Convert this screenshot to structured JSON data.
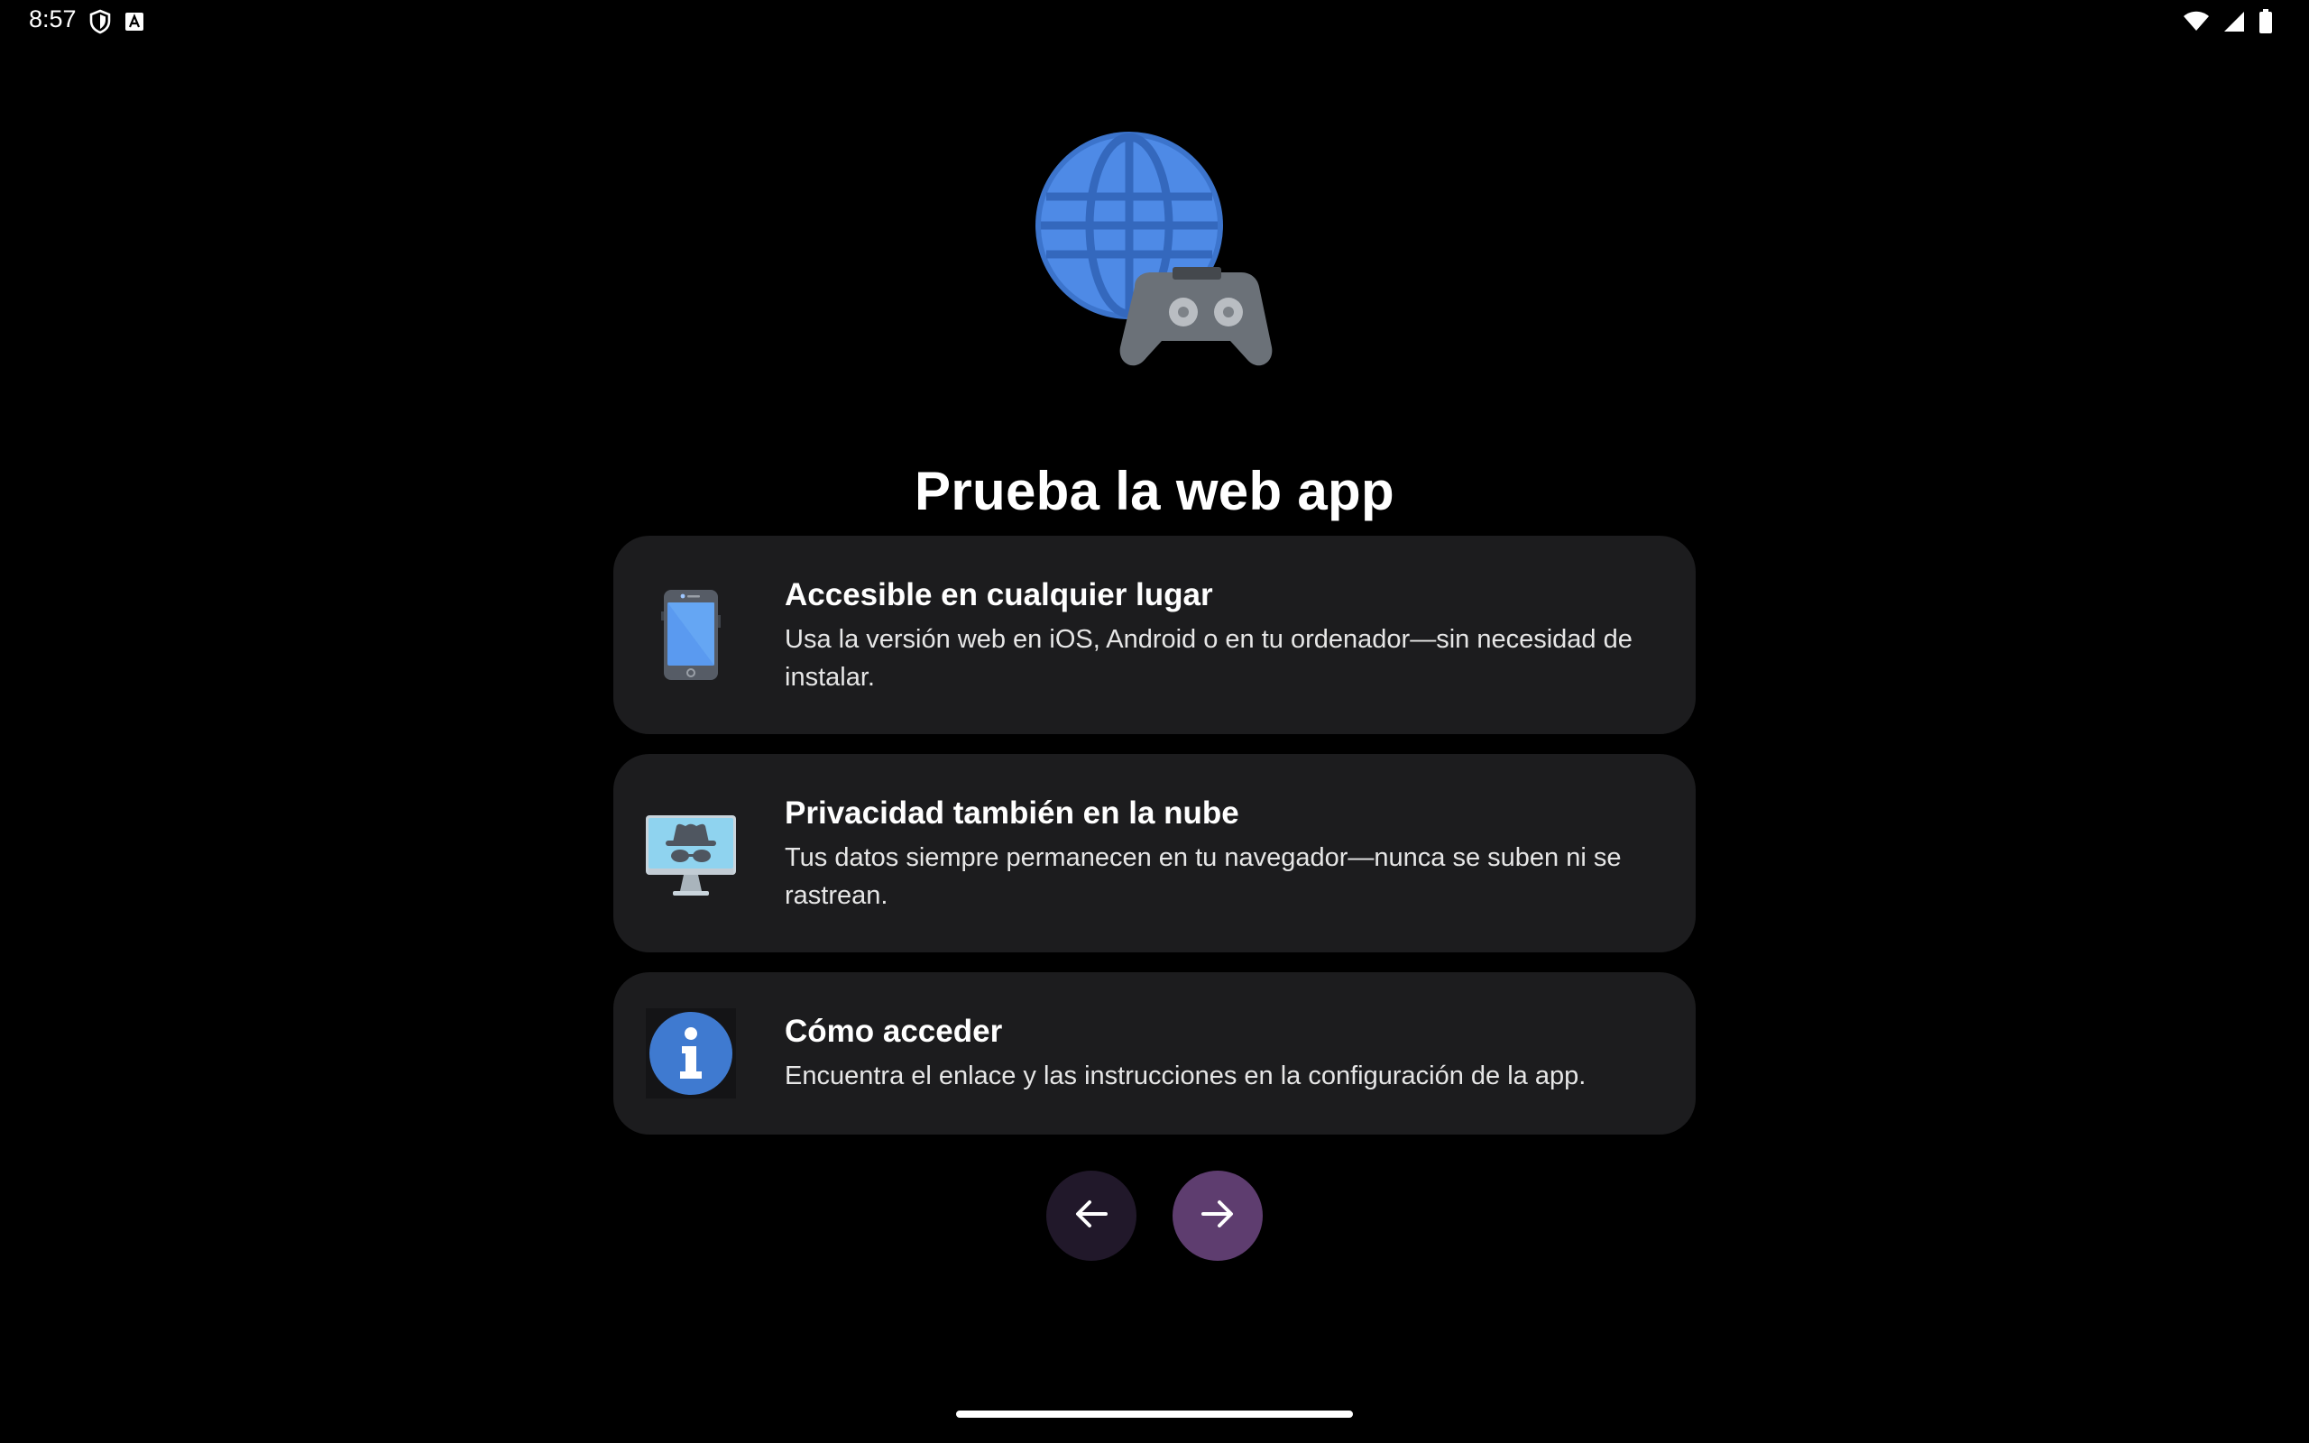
{
  "status_bar": {
    "time": "8:57",
    "left_icons": [
      "shield-icon",
      "accessibility-a-icon"
    ],
    "right_icons": [
      "wifi-icon",
      "signal-icon",
      "battery-icon"
    ]
  },
  "hero": {
    "icons": [
      "globe-icon",
      "gamepad-icon"
    ],
    "title": "Prueba la web app"
  },
  "cards": [
    {
      "icon": "smartphone-icon",
      "title": "Accesible en cualquier lugar",
      "body": "Usa la versión web en iOS, Android o en tu ordenador—sin necesidad de instalar."
    },
    {
      "icon": "incognito-monitor-icon",
      "title": "Privacidad también en la nube",
      "body": "Tus datos siempre permanecen en tu navegador—nunca se suben ni se rastrean."
    },
    {
      "icon": "info-icon",
      "title": "Cómo acceder",
      "body": "Encuentra el enlace y las instrucciones en la configuración de la app."
    }
  ],
  "navigation": {
    "back_icon": "arrow-left-icon",
    "next_icon": "arrow-right-icon"
  },
  "colors": {
    "background": "#000000",
    "card": "#1c1c1e",
    "back_button": "#21182a",
    "next_button": "#5e3d6f",
    "globe": "#4a86e0",
    "gamepad": "#6b7178"
  }
}
